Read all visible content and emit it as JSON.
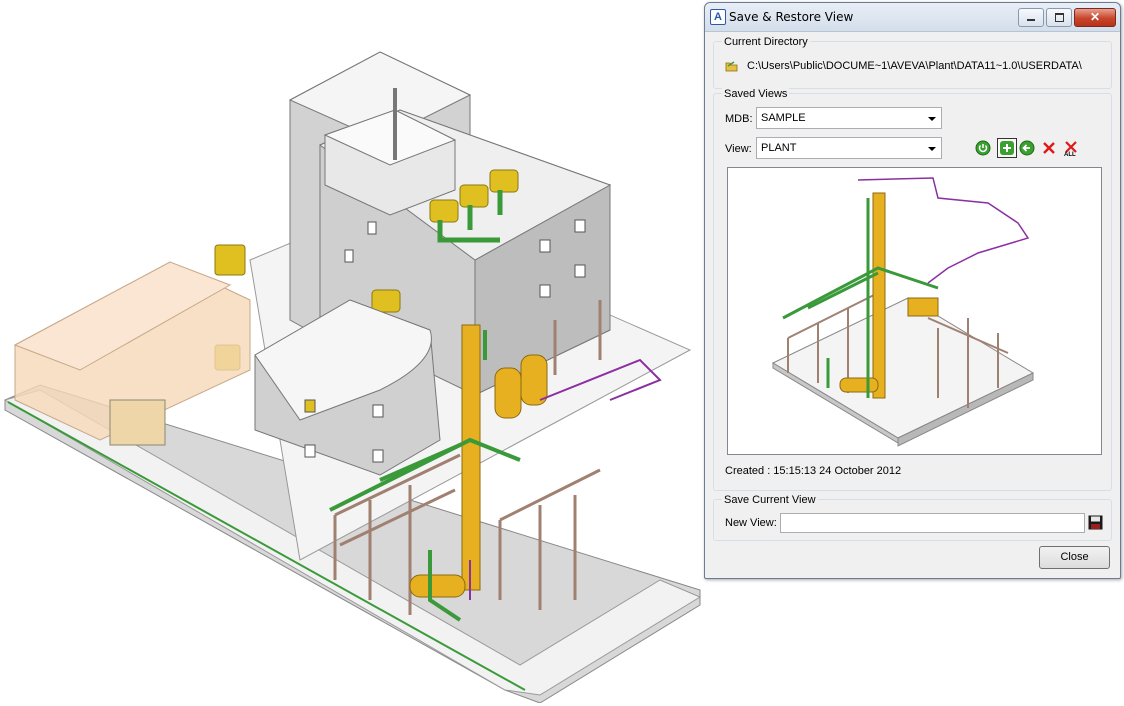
{
  "dialog": {
    "title": "Save & Restore View",
    "current_directory": {
      "label": "Current Directory",
      "path": "C:\\Users\\Public\\DOCUME~1\\AVEVA\\Plant\\DATA11~1.0\\USERDATA\\"
    },
    "saved_views": {
      "label": "Saved Views",
      "mdb_label": "MDB:",
      "mdb_value": "SAMPLE",
      "view_label": "View:",
      "view_value": "PLANT",
      "toolbar": [
        "restore-icon",
        "add-icon",
        "back-icon",
        "delete-icon",
        "delete-all-icon"
      ],
      "created": "Created : 15:15:13 24 October 2012"
    },
    "save_current_view": {
      "label": "Save Current View",
      "new_view_label": "New View:",
      "new_view_value": ""
    },
    "close_label": "Close"
  },
  "colors": {
    "equipment": "#e0b020",
    "pipe_green": "#4aa02c",
    "pipe_purple": "#8a30a0",
    "steel": "#a08070",
    "building": "#c8c8c8",
    "window_frame_accent": "#d0141c"
  }
}
